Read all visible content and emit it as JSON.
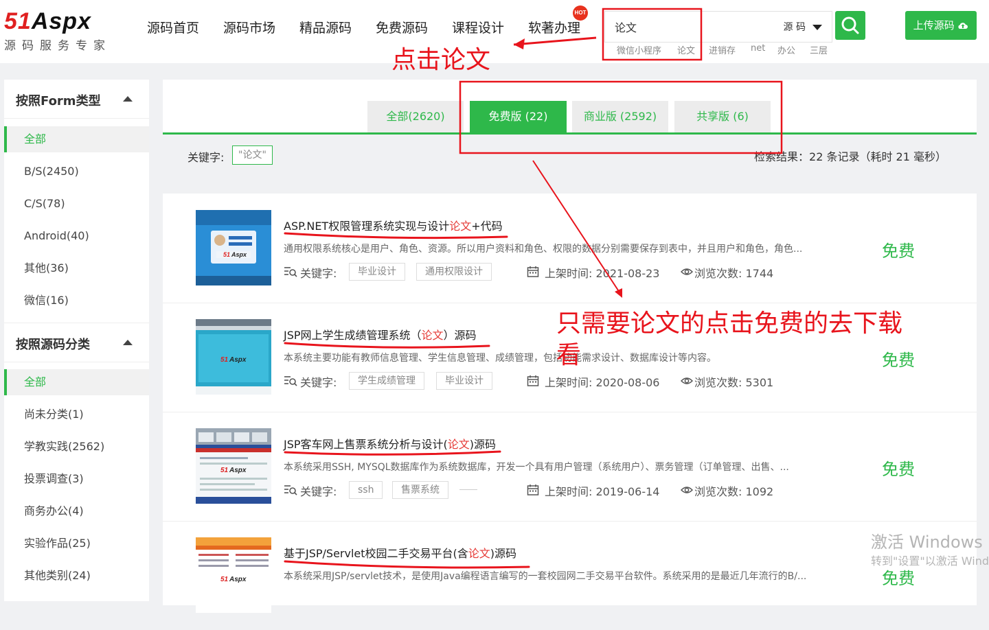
{
  "logo": {
    "brand_51": "51",
    "brand_aspx": "Aspx",
    "tagline": "源码服务专家"
  },
  "nav": {
    "items": [
      {
        "label": "源码首页"
      },
      {
        "label": "源码市场"
      },
      {
        "label": "精品源码"
      },
      {
        "label": "免费源码"
      },
      {
        "label": "课程设计"
      },
      {
        "label": "软著办理"
      }
    ],
    "hot_badge": "HOT"
  },
  "search": {
    "value": "论文",
    "type_label": "源 码",
    "hot_tags": [
      "微信小程序",
      "论文",
      "进销存",
      "net",
      "办公",
      "三层"
    ]
  },
  "upload_button": "上传源码",
  "sidebar": {
    "section1": {
      "title": "按照Form类型",
      "items": [
        {
          "label": "全部",
          "active": true
        },
        {
          "label": "B/S(2450)"
        },
        {
          "label": "C/S(78)"
        },
        {
          "label": "Android(40)"
        },
        {
          "label": "其他(36)"
        },
        {
          "label": "微信(16)"
        }
      ]
    },
    "section2": {
      "title": "按照源码分类",
      "items": [
        {
          "label": "全部",
          "active": true
        },
        {
          "label": "尚未分类(1)"
        },
        {
          "label": "学教实践(2562)"
        },
        {
          "label": "投票调查(3)"
        },
        {
          "label": "商务办公(4)"
        },
        {
          "label": "实验作品(25)"
        },
        {
          "label": "其他类别(24)"
        }
      ]
    }
  },
  "tabs": [
    {
      "label": "全部(2620)",
      "active": false
    },
    {
      "label": "免费版 (22)",
      "active": true
    },
    {
      "label": "商业版 (2592)",
      "active": false
    },
    {
      "label": "共享版 (6)",
      "active": false
    }
  ],
  "filter": {
    "keyword_label": "关键字:",
    "keyword_chip": "\"论文\"",
    "result_text": "检索结果：22 条记录（耗时 21 毫秒）"
  },
  "meta_labels": {
    "keyword": "关键字:",
    "date": "上架时间:",
    "views": "浏览次数:"
  },
  "results": [
    {
      "title_pre": "ASP.NET权限管理系统实现与设计",
      "title_hl": "论文",
      "title_post": "+代码",
      "desc": "通用权限系统核心是用户、角色、资源。所以用户资料和角色、权限的数据分别需要保存到表中，并且用户和角色，角色...",
      "tags": [
        "毕业设计",
        "通用权限设计"
      ],
      "date": "2021-08-23",
      "views": "1744",
      "price": "免费"
    },
    {
      "title_pre": "JSP网上学生成绩管理系统（",
      "title_hl": "论文",
      "title_post": "）源码",
      "desc": "本系统主要功能有教师信息管理、学生信息管理、成绩管理，包括功能需求设计、数据库设计等内容。",
      "tags": [
        "学生成绩管理",
        "毕业设计"
      ],
      "date": "2020-08-06",
      "views": "5301",
      "price": "免费"
    },
    {
      "title_pre": "JSP客车网上售票系统分析与设计(",
      "title_hl": "论文",
      "title_post": ")源码",
      "desc": "本系统采用SSH, MYSQL数据库作为系统数据库，开发一个具有用户管理（系统用户）、票务管理（订单管理、出售、...",
      "tags": [
        "ssh",
        "售票系统"
      ],
      "date": "2019-06-14",
      "views": "1092",
      "price": "免费"
    },
    {
      "title_pre": "基于JSP/Servlet校园二手交易平台(含",
      "title_hl": "论文",
      "title_post": ")源码",
      "desc": "本系统采用JSP/servlet技术，是使用Java编程语言编写的一套校园网二手交易平台软件。系统采用的是最近几年流行的B/...",
      "tags": [],
      "date": "",
      "views": "",
      "price": "免费"
    }
  ],
  "annotations": {
    "click_note": "点击论文",
    "free_note_line1": "只需要论文的点击免费的去下载",
    "free_note_line2": "看",
    "annotation_color": "#e8141c"
  },
  "watermark": {
    "line1": "激活 Windows",
    "line2": "转到\"设置\"以激活 Windows。"
  },
  "colors": {
    "accent_green": "#2eb84a",
    "highlight_red": "#e53935"
  }
}
